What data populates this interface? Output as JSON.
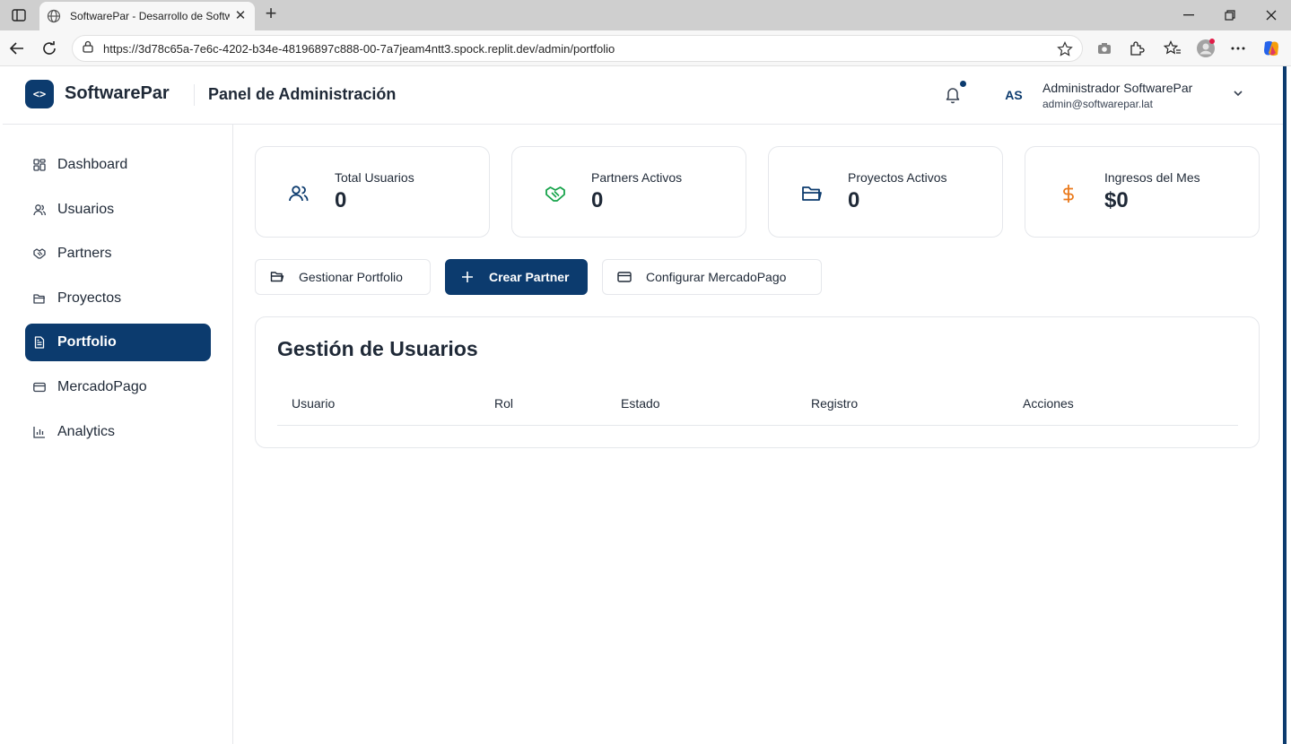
{
  "browser": {
    "tab_title": "SoftwarePar - Desarrollo de Software",
    "url": "https://3d78c65a-7e6c-4202-b34e-48196897c888-00-7a7jeam4ntt3.spock.replit.dev/admin/portfolio"
  },
  "header": {
    "logo_glyph": "<>",
    "brand": "SoftwarePar",
    "panel_title": "Panel de Administración",
    "avatar_initials": "AS",
    "user_name": "Administrador SoftwarePar",
    "user_email": "admin@softwarepar.lat"
  },
  "sidebar": {
    "items": [
      {
        "label": "Dashboard",
        "icon": "grid-icon"
      },
      {
        "label": "Usuarios",
        "icon": "user-icon"
      },
      {
        "label": "Partners",
        "icon": "handshake-icon"
      },
      {
        "label": "Proyectos",
        "icon": "folder-icon"
      },
      {
        "label": "Portfolio",
        "icon": "document-icon",
        "active": true
      },
      {
        "label": "MercadoPago",
        "icon": "credit-card-icon"
      },
      {
        "label": "Analytics",
        "icon": "bar-chart-icon"
      }
    ]
  },
  "stats": [
    {
      "label": "Total Usuarios",
      "value": "0",
      "icon": "users-icon",
      "color": "#0c3b6e"
    },
    {
      "label": "Partners Activos",
      "value": "0",
      "icon": "handshake-icon",
      "color": "#16a34a"
    },
    {
      "label": "Proyectos Activos",
      "value": "0",
      "icon": "folder-icon",
      "color": "#0c3b6e"
    },
    {
      "label": "Ingresos del Mes",
      "value": "$0",
      "icon": "dollar-icon",
      "color": "#ea7a1c"
    }
  ],
  "actions": {
    "portfolio": "Gestionar Portfolio",
    "create_partner": "Crear Partner",
    "mercadopago": "Configurar MercadoPago"
  },
  "users_table": {
    "title": "Gestión de Usuarios",
    "columns": [
      "Usuario",
      "Rol",
      "Estado",
      "Registro",
      "Acciones"
    ]
  },
  "colors": {
    "brand": "#0c3b6e",
    "success": "#16a34a",
    "warning": "#ea7a1c"
  }
}
